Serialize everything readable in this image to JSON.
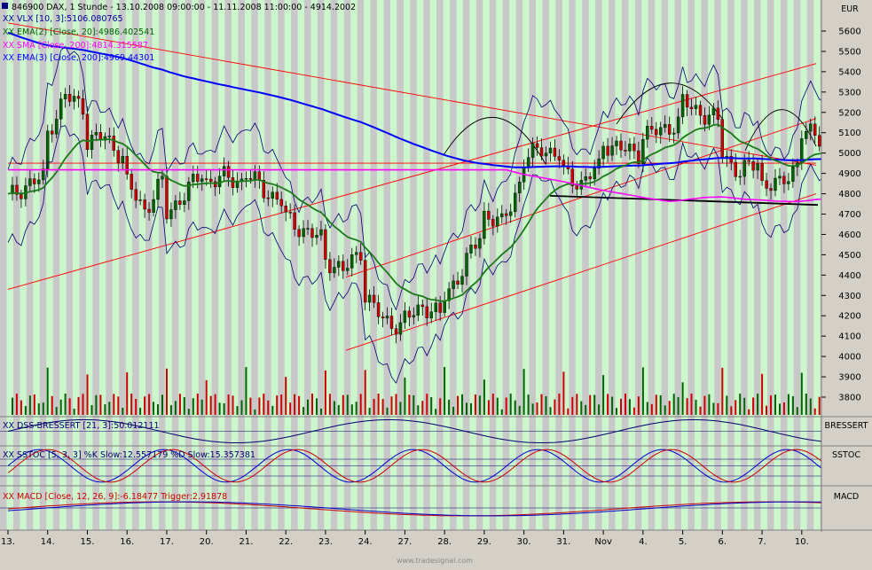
{
  "header": {
    "symbol_line": "846900  DAX, 1 Stunde - 13.10.2008 09:00:00 - 11.11.2008 11:00:00 - 4914.2002",
    "currency": "EUR"
  },
  "legend": [
    {
      "text": "XX VLX [10, 3]:5106.080765",
      "color": "#0000a0"
    },
    {
      "text": "XX EMA(2) [Close, 20]:4986.402541",
      "color": "#006400"
    },
    {
      "text": "XX SMA [Close, 200]:4814.315587",
      "color": "#ff00ff"
    },
    {
      "text": "XX EMA(3) [Close, 200]:4969.44301",
      "color": "#0000ff"
    }
  ],
  "panels": {
    "dss": {
      "label": "XX DSS-BRESSERT [21, 3]:50.012111",
      "tag": "BRESSERT"
    },
    "sstoc": {
      "label": "XX SSTOC [5, 3, 3] %K Slow:12.557179 %D Slow:15.357381",
      "tag": "SSTOC"
    },
    "macd": {
      "label": "XX MACD [Close, 12, 26, 9]:-6.18477 Trigger:2.91878",
      "tag": "MACD"
    }
  },
  "footer": "www.tradesignal.com",
  "colors": {
    "bg": "#d4d0c8",
    "band_green": "#ccf6cc",
    "band_gray": "#c8c8c8",
    "up": "#006400",
    "down": "#cc0000",
    "ema20": "#1a7a1a",
    "ema200": "#0000ff",
    "sma200": "#ff00ff",
    "vlx": "#00006e",
    "trend": "#ff0000",
    "support": "#000000"
  },
  "chart_data": {
    "type": "candlestick",
    "title": "846900  DAX, 1 Stunde - 13.10.2008 09:00:00 - 11.11.2008 11:00:00 - 4914.2002",
    "ylabel": "EUR",
    "ylim": [
      3700,
      5800
    ],
    "y_ticks": [
      3800,
      3900,
      4000,
      4100,
      4200,
      4300,
      4400,
      4500,
      4600,
      4700,
      4800,
      4900,
      5000,
      5100,
      5200,
      5300,
      5400,
      5500,
      5600
    ],
    "x_ticks": [
      "13.",
      "14.",
      "15.",
      "16.",
      "17.",
      "20.",
      "21.",
      "22.",
      "23.",
      "24.",
      "27.",
      "28.",
      "29.",
      "30.",
      "31.",
      "Nov",
      "4.",
      "5.",
      "6.",
      "7.",
      "10."
    ],
    "close_path": [
      [
        "13.",
        4780
      ],
      [
        "13.",
        4840
      ],
      [
        "13.",
        4880
      ],
      [
        "14.",
        5100
      ],
      [
        "14.",
        5280
      ],
      [
        "14.",
        5230
      ],
      [
        "15.",
        5060
      ],
      [
        "15.",
        5080
      ],
      [
        "15.",
        4980
      ],
      [
        "16.",
        4850
      ],
      [
        "16.",
        4720
      ],
      [
        "16.",
        4860
      ],
      [
        "17.",
        4700
      ],
      [
        "17.",
        4800
      ],
      [
        "17.",
        4900
      ],
      [
        "20.",
        4860
      ],
      [
        "20.",
        4880
      ],
      [
        "20.",
        4860
      ],
      [
        "21.",
        4900
      ],
      [
        "21.",
        4820
      ],
      [
        "21.",
        4760
      ],
      [
        "22.",
        4680
      ],
      [
        "22.",
        4620
      ],
      [
        "22.",
        4580
      ],
      [
        "23.",
        4480
      ],
      [
        "23.",
        4420
      ],
      [
        "23.",
        4520
      ],
      [
        "24.",
        4300
      ],
      [
        "24.",
        4180
      ],
      [
        "24.",
        4150
      ],
      [
        "27.",
        4180
      ],
      [
        "27.",
        4250
      ],
      [
        "27.",
        4200
      ],
      [
        "28.",
        4300
      ],
      [
        "28.",
        4420
      ],
      [
        "28.",
        4600
      ],
      [
        "29.",
        4700
      ],
      [
        "29.",
        4650
      ],
      [
        "29.",
        4850
      ],
      [
        "30.",
        4960
      ],
      [
        "30.",
        5030
      ],
      [
        "30.",
        4980
      ],
      [
        "31.",
        4900
      ],
      [
        "31.",
        4850
      ],
      [
        "31.",
        4930
      ],
      [
        "Nov",
        5050
      ],
      [
        "Nov",
        5020
      ],
      [
        "Nov",
        5000
      ],
      [
        "4.",
        5090
      ],
      [
        "4.",
        5110
      ],
      [
        "4.",
        5150
      ],
      [
        "5.",
        5250
      ],
      [
        "5.",
        5200
      ],
      [
        "5.",
        5160
      ],
      [
        "6.",
        5000
      ],
      [
        "6.",
        4900
      ],
      [
        "6.",
        4960
      ],
      [
        "7.",
        4850
      ],
      [
        "7.",
        4840
      ],
      [
        "7.",
        4950
      ],
      [
        "10.",
        5100
      ],
      [
        "10.",
        5080
      ],
      [
        "10.",
        4914
      ]
    ],
    "overlays": [
      {
        "name": "VLX [10, 3]",
        "last": 5106.080765
      },
      {
        "name": "EMA(2) [Close, 20]",
        "last": 4986.402541
      },
      {
        "name": "SMA [Close, 200]",
        "last": 4814.315587
      },
      {
        "name": "EMA(3) [Close, 200]",
        "last": 4969.44301
      }
    ],
    "indicators": [
      {
        "name": "DSS-BRESSERT [21, 3]",
        "value": 50.012111
      },
      {
        "name": "SSTOC [5, 3, 3] %K Slow",
        "value": 12.557179
      },
      {
        "name": "SSTOC [5, 3, 3] %D Slow",
        "value": 15.357381
      },
      {
        "name": "MACD [Close, 12, 26, 9]",
        "value": -6.18477
      },
      {
        "name": "MACD Trigger",
        "value": 2.91878
      }
    ],
    "grid": false,
    "legend_position": "top-left"
  }
}
